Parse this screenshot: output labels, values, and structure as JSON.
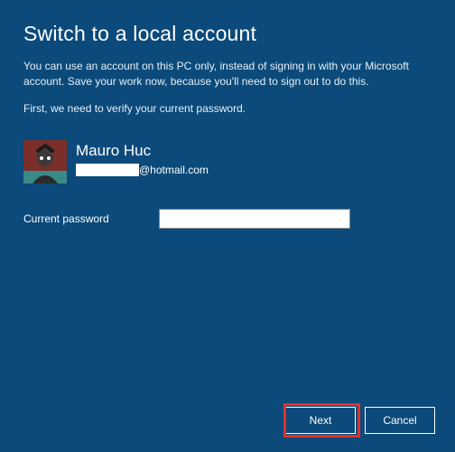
{
  "title": "Switch to a local account",
  "description": "You can use an account on this PC only, instead of signing in with your Microsoft account. Save your work now, because you'll need to sign out to do this.",
  "verify_text": "First, we need to verify your current password.",
  "user": {
    "name": "Mauro Huc",
    "email_domain": "@hotmail.com"
  },
  "password": {
    "label": "Current password",
    "value": ""
  },
  "buttons": {
    "next": "Next",
    "cancel": "Cancel"
  }
}
